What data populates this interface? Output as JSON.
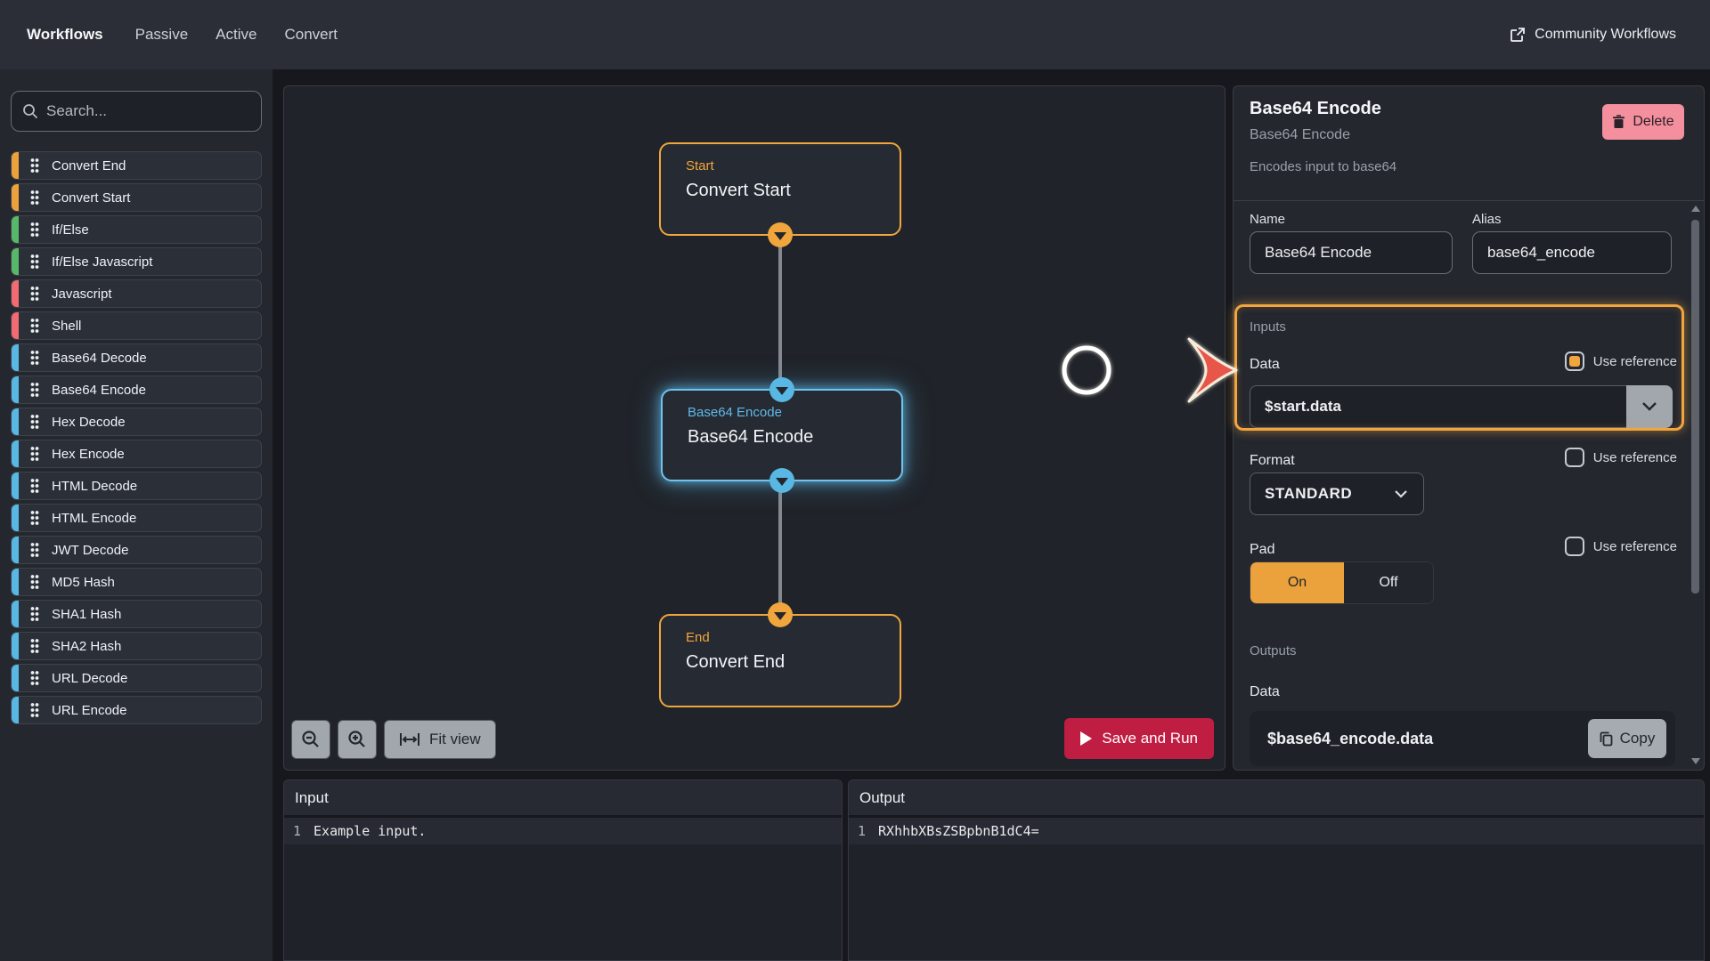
{
  "nav": {
    "items": [
      {
        "label": "Workflows",
        "active": true
      },
      {
        "label": "Passive",
        "active": false
      },
      {
        "label": "Active",
        "active": false
      },
      {
        "label": "Convert",
        "active": false
      }
    ],
    "community_label": "Community Workflows"
  },
  "sidebar": {
    "search_placeholder": "Search...",
    "items": [
      {
        "label": "Convert End",
        "color": "#eba23c"
      },
      {
        "label": "Convert Start",
        "color": "#eba23c"
      },
      {
        "label": "If/Else",
        "color": "#57b869"
      },
      {
        "label": "If/Else Javascript",
        "color": "#57b869"
      },
      {
        "label": "Javascript",
        "color": "#f16c72"
      },
      {
        "label": "Shell",
        "color": "#f16c72"
      },
      {
        "label": "Base64 Decode",
        "color": "#58b7e3"
      },
      {
        "label": "Base64 Encode",
        "color": "#58b7e3"
      },
      {
        "label": "Hex Decode",
        "color": "#58b7e3"
      },
      {
        "label": "Hex Encode",
        "color": "#58b7e3"
      },
      {
        "label": "HTML Decode",
        "color": "#58b7e3"
      },
      {
        "label": "HTML Encode",
        "color": "#58b7e3"
      },
      {
        "label": "JWT Decode",
        "color": "#58b7e3"
      },
      {
        "label": "MD5 Hash",
        "color": "#58b7e3"
      },
      {
        "label": "SHA1 Hash",
        "color": "#58b7e3"
      },
      {
        "label": "SHA2 Hash",
        "color": "#58b7e3"
      },
      {
        "label": "URL Decode",
        "color": "#58b7e3"
      },
      {
        "label": "URL Encode",
        "color": "#58b7e3"
      }
    ]
  },
  "canvas": {
    "nodes": [
      {
        "title": "Start",
        "label": "Convert Start",
        "accent": "#f0a63c"
      },
      {
        "title": "Base64 Encode",
        "label": "Base64 Encode",
        "accent": "#58b7e3",
        "selected": true
      },
      {
        "title": "End",
        "label": "Convert End",
        "accent": "#f0a63c"
      }
    ],
    "controls": {
      "fit_view_label": "Fit view"
    },
    "run_label": "Save and Run"
  },
  "inspector": {
    "title": "Base64 Encode",
    "subtitle": "Base64 Encode",
    "description": "Encodes input to base64",
    "delete_label": "Delete",
    "name": {
      "label": "Name",
      "value": "Base64 Encode"
    },
    "alias": {
      "label": "Alias",
      "value": "base64_encode"
    },
    "inputs": {
      "section_label": "Inputs",
      "data": {
        "label": "Data",
        "use_reference_label": "Use reference",
        "checked": true,
        "value": "$start.data"
      },
      "format": {
        "label": "Format",
        "use_reference_label": "Use reference",
        "checked": false,
        "value": "STANDARD"
      },
      "pad": {
        "label": "Pad",
        "use_reference_label": "Use reference",
        "checked": false,
        "on": "On",
        "off": "Off",
        "state": "On"
      }
    },
    "outputs": {
      "section_label": "Outputs",
      "data_label": "Data",
      "value": "$base64_encode.data",
      "copy_label": "Copy"
    }
  },
  "io_panels": {
    "input": {
      "title": "Input",
      "line_number": "1",
      "content": "Example input."
    },
    "output": {
      "title": "Output",
      "line_number": "1",
      "content": "RXhhbXBsZSBpbnB1dC4="
    }
  },
  "icons": {
    "community": "external-link-icon",
    "search": "magnifier-icon",
    "drag_handle": "six-dot-drag-handle-icon",
    "zoom_out": "magnifier-minus-icon",
    "zoom_in": "magnifier-plus-icon",
    "fit_view": "fit-width-icon",
    "run": "play-icon",
    "delete": "trash-icon",
    "dropdown": "chevron-down-icon",
    "copy": "copy-icon",
    "node_port": "chevron-down-handle",
    "annotation": "circle-and-arrow"
  },
  "colors": {
    "accent_orange": "#f0a63c",
    "accent_blue": "#58b7e3",
    "accent_green": "#57b869",
    "accent_red": "#f16c72",
    "run_button": "#c01d43",
    "delete_button": "#f48f9e",
    "highlight_annotation": "#f2a43e",
    "panel_bg": "#24272e",
    "canvas_bg": "#202329",
    "nav_bg": "#2b2e36"
  }
}
